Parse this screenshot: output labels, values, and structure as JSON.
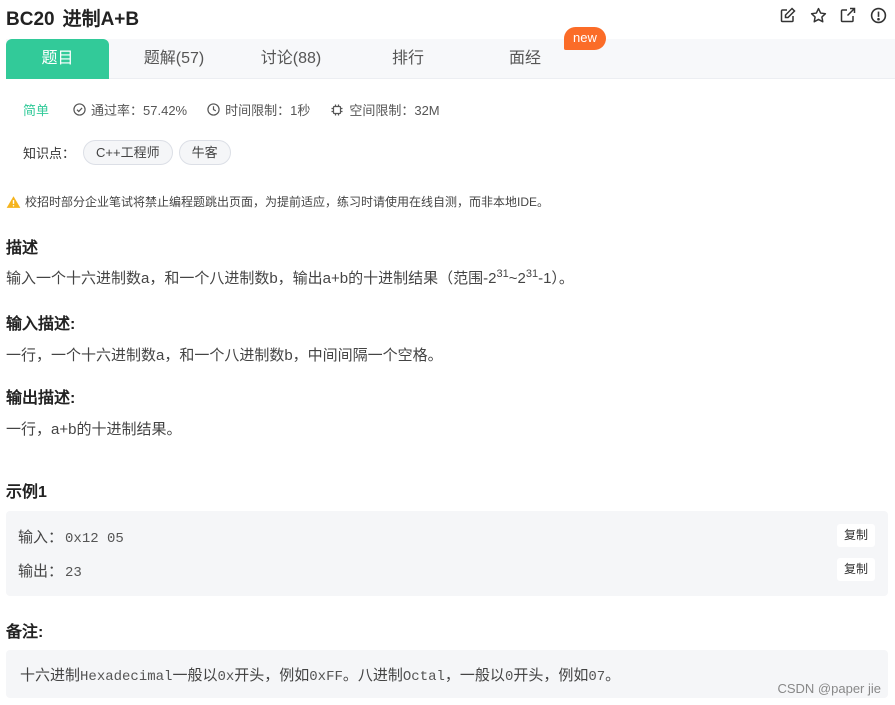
{
  "problem": {
    "id": "BC20",
    "title": "进制A+B"
  },
  "toolbar": {
    "icons": [
      "edit-icon",
      "star-icon",
      "share-icon",
      "info-icon"
    ]
  },
  "tabs": [
    {
      "label": "题目",
      "active": true
    },
    {
      "label": "题解(57)",
      "active": false
    },
    {
      "label": "讨论(88)",
      "active": false
    },
    {
      "label": "排行",
      "active": false
    },
    {
      "label": "面经",
      "active": false
    }
  ],
  "new_badge": "new",
  "meta": {
    "difficulty": "简单",
    "pass_rate": "通过率：57.42%",
    "time_limit": "时间限制：1秒",
    "space_limit": "空间限制：32M"
  },
  "knowledge": {
    "label": "知识点：",
    "tags": [
      "C++工程师",
      "牛客"
    ]
  },
  "warning": "校招时部分企业笔试将禁止编程题跳出页面，为提前适应，练习时请使用在线自测，而非本地IDE。",
  "description": {
    "heading": "描述",
    "text_before": "输入一个十六进制数a，和一个八进制数b，输出a+b的十进制结果（范围-2",
    "sup1": "31",
    "text_mid": "~2",
    "sup2": "31",
    "text_after": "-1）。"
  },
  "input_desc": {
    "heading": "输入描述:",
    "text": "一行，一个十六进制数a，和一个八进制数b，中间间隔一个空格。"
  },
  "output_desc": {
    "heading": "输出描述:",
    "text": "一行，a+b的十进制结果。"
  },
  "example": {
    "heading": "示例1",
    "input_label": "输入：",
    "input_value": "0x12 05",
    "output_label": "输出：",
    "output_value": "23",
    "copy_label": "复制"
  },
  "note": {
    "heading": "备注:",
    "parts": [
      "十六进制",
      "Hexadecimal",
      "一般以",
      "0x",
      "开头，例如",
      "0xFF",
      "。八进制",
      "Octal",
      "，一般以",
      "0",
      "开头，例如",
      "07",
      "。"
    ]
  },
  "watermark": "CSDN @paper jie"
}
